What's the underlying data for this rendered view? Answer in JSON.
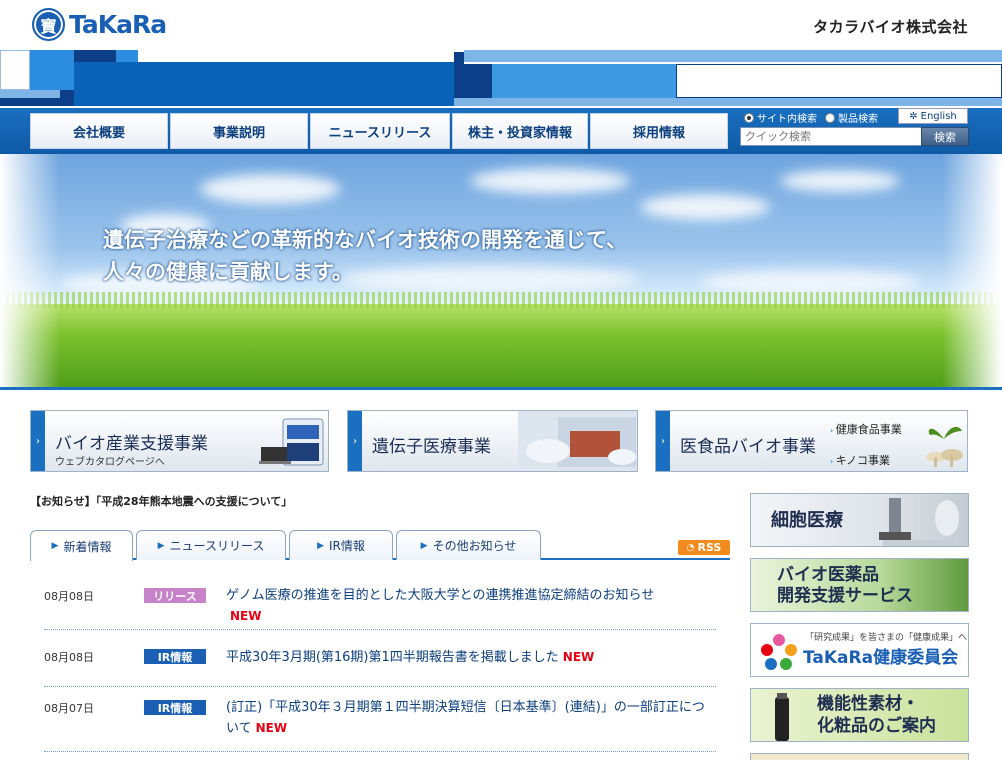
{
  "header": {
    "logo_seal": "寶",
    "logo_text": "TaKaRa",
    "company_name": "タカラバイオ株式会社"
  },
  "nav": {
    "items": [
      "会社概要",
      "事業説明",
      "ニュースリリース",
      "株主・投資家情報",
      "採用情報"
    ]
  },
  "search": {
    "radio_site": "サイト内検索",
    "radio_product": "製品検索",
    "english": "English",
    "placeholder": "クイック検索",
    "button": "検索"
  },
  "hero": {
    "line1": "遺伝子治療などの革新的なバイオ技術の開発を通じて、",
    "line2": "人々の健康に貢献します。"
  },
  "business": [
    {
      "title": "バイオ産業支援事業",
      "sub": "ウェブカタログページへ"
    },
    {
      "title": "遺伝子医療事業"
    },
    {
      "title": "医食品バイオ事業",
      "links": [
        "健康食品事業",
        "キノコ事業"
      ]
    }
  ],
  "notice": "【お知らせ】「平成28年熊本地震への支援について」",
  "tabs": [
    "新着情報",
    "ニュースリリース",
    "IR情報",
    "その他お知らせ"
  ],
  "rss": "RSS",
  "news": [
    {
      "date": "08月08日",
      "badge": "リリース",
      "badge_color": "#c783c9",
      "text": "ゲノム医療の推進を目的とした大阪大学との連携推進協定締結のお知らせ",
      "new": "NEW"
    },
    {
      "date": "08月08日",
      "badge": "IR情報",
      "badge_color": "#1a5fb4",
      "text": "平成30年3月期(第16期)第1四半期報告書を掲載しました",
      "new": "NEW"
    },
    {
      "date": "08月07日",
      "badge": "IR情報",
      "badge_color": "#1a5fb4",
      "text": "(訂正)「平成30年３月期第１四半期決算短信〔日本基準〕(連結)」の一部訂正について",
      "new": "NEW"
    }
  ],
  "side_banners": {
    "cell": "細胞医療",
    "biopharma_line1": "バイオ医薬品",
    "biopharma_line2": "開発支援サービス",
    "committee_caption": "「研究成果」を皆さまの「健康成果」へ",
    "committee_title": "TaKaRa健康委員会",
    "materials_line1": "機能性素材・",
    "materials_line2": "化粧品のご案内"
  },
  "colors": {
    "brand_blue": "#1a6fc0",
    "new_red": "#e60012",
    "rss_orange": "#f28a1d"
  }
}
